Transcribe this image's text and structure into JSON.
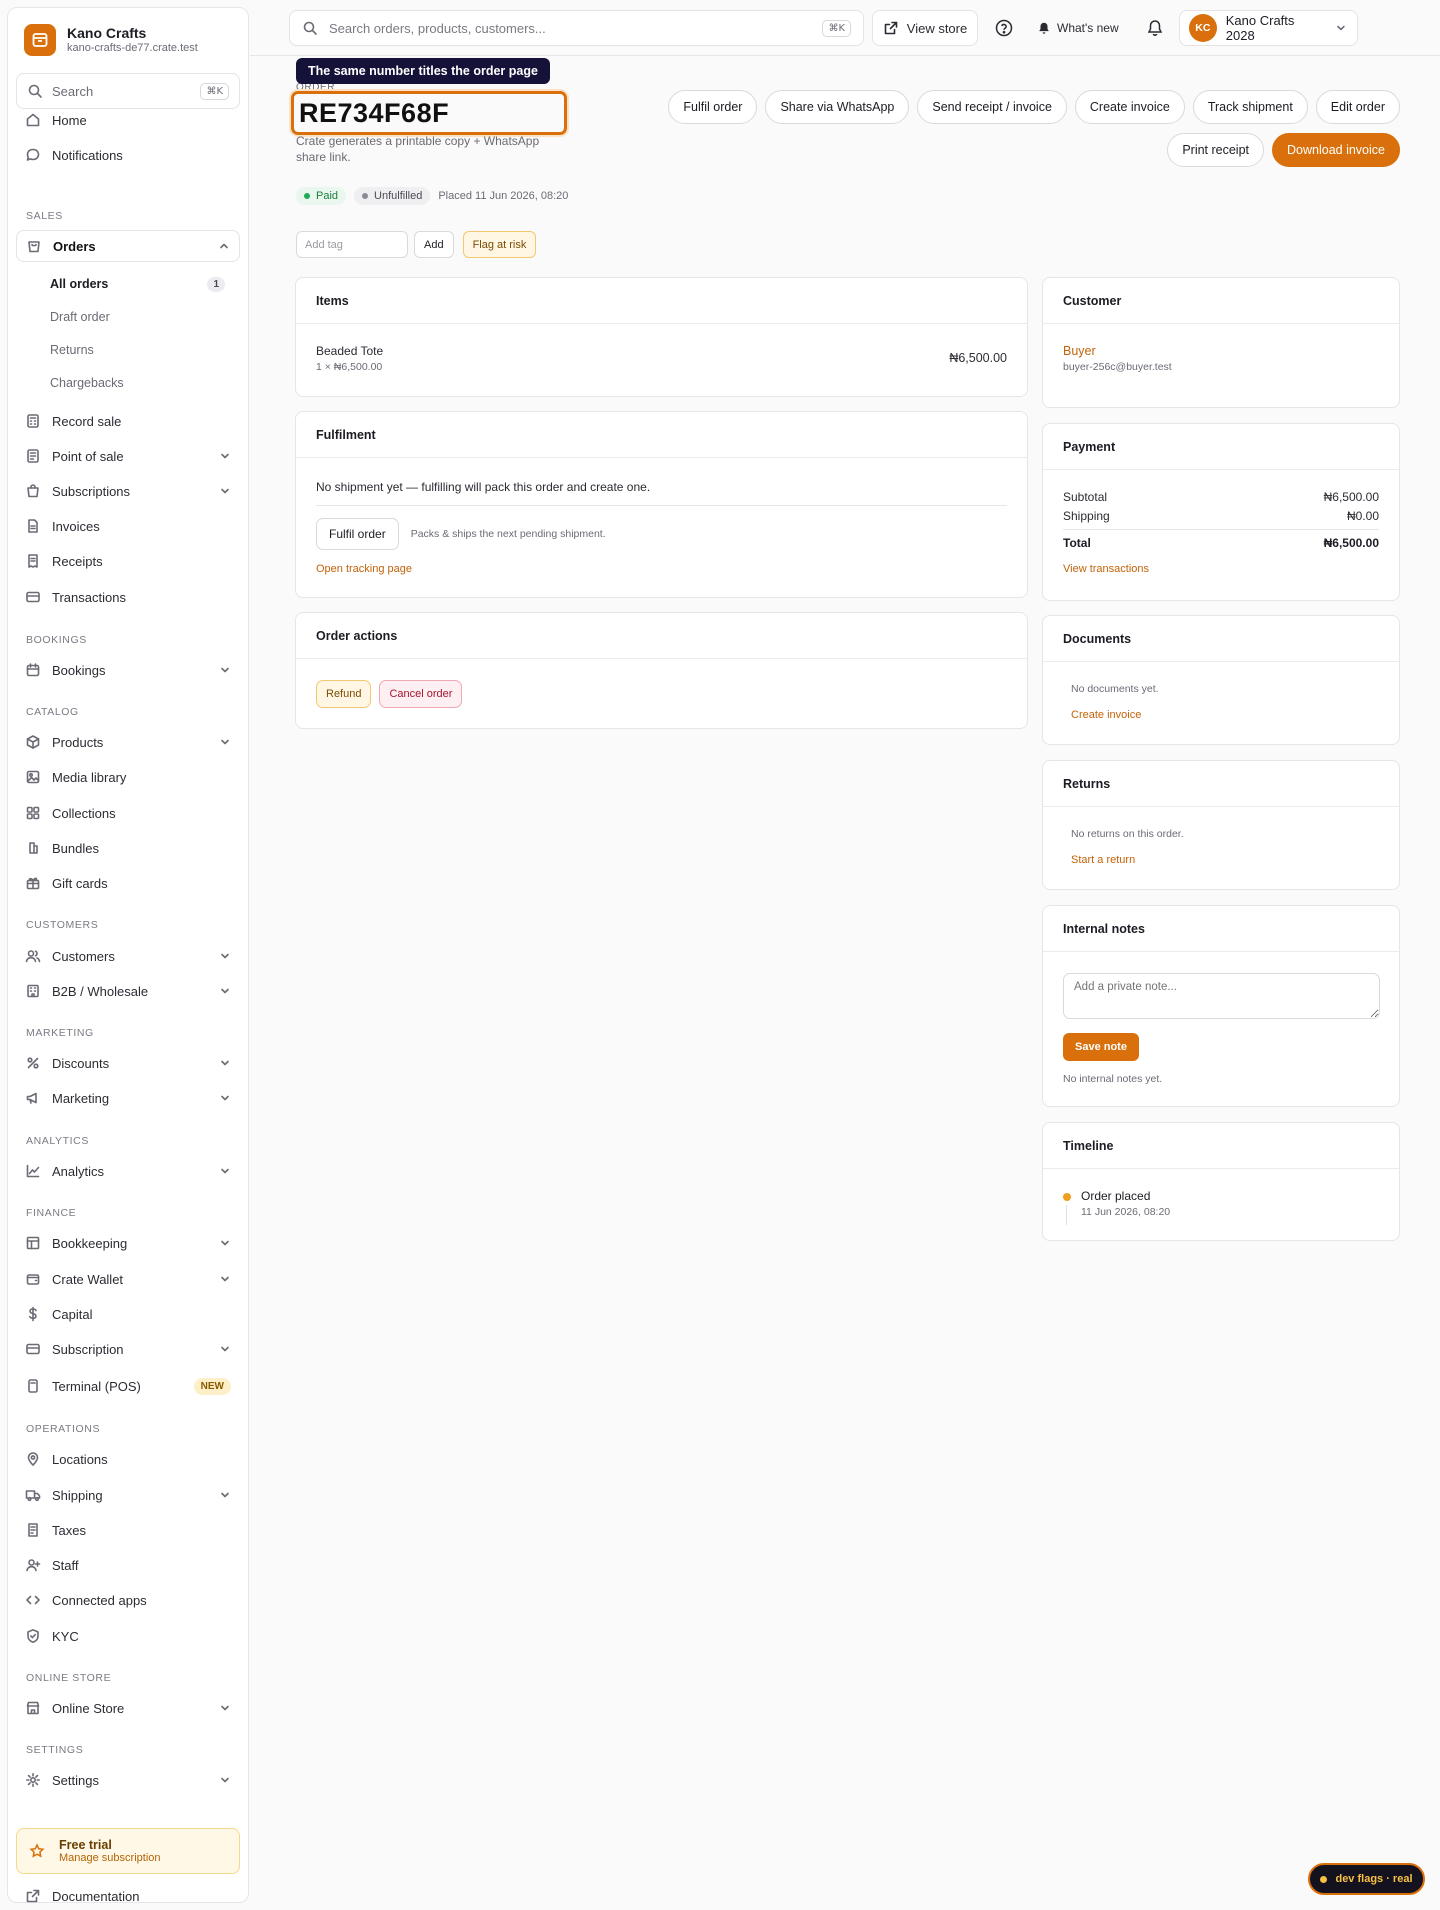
{
  "brand": {
    "name": "Kano Crafts",
    "url": "kano-crafts-de77.crate.test"
  },
  "sidebar": {
    "search_placeholder": "Search",
    "search_shortcut": "⌘K",
    "home": "Home",
    "notifications": "Notifications",
    "sections": {
      "sales": "SALES",
      "bookings": "BOOKINGS",
      "catalog": "CATALOG",
      "customers": "CUSTOMERS",
      "marketing": "MARKETING",
      "analytics": "ANALYTICS",
      "finance": "FINANCE",
      "operations": "OPERATIONS",
      "online_store": "ONLINE STORE",
      "settings": "SETTINGS"
    },
    "orders": "Orders",
    "orders_sub": {
      "all": "All orders",
      "all_count": "1",
      "draft": "Draft order",
      "returns": "Returns",
      "chargebacks": "Chargebacks"
    },
    "record_sale": "Record sale",
    "point_of_sale": "Point of sale",
    "subscriptions": "Subscriptions",
    "invoices": "Invoices",
    "receipts": "Receipts",
    "transactions": "Transactions",
    "bookings": "Bookings",
    "products": "Products",
    "media_library": "Media library",
    "collections": "Collections",
    "bundles": "Bundles",
    "gift_cards": "Gift cards",
    "customers": "Customers",
    "b2b": "B2B / Wholesale",
    "discounts": "Discounts",
    "marketing": "Marketing",
    "analytics": "Analytics",
    "bookkeeping": "Bookkeeping",
    "crate_wallet": "Crate Wallet",
    "capital": "Capital",
    "subscription": "Subscription",
    "terminal": "Terminal (POS)",
    "terminal_badge": "NEW",
    "locations": "Locations",
    "shipping": "Shipping",
    "taxes": "Taxes",
    "staff": "Staff",
    "connected_apps": "Connected apps",
    "kyc": "KYC",
    "online_store": "Online Store",
    "settings": "Settings",
    "trial_title": "Free trial",
    "trial_sub": "Manage subscription",
    "documentation": "Documentation"
  },
  "topbar": {
    "search_placeholder": "Search orders, products, customers...",
    "search_shortcut": "⌘K",
    "view_store": "View store",
    "whats_new": "What's new",
    "avatar_initials": "KC",
    "account_name": "Kano Crafts 2028"
  },
  "order": {
    "tooltip": "The same number titles the order page",
    "label": "ORDER",
    "number": "RE734F68F",
    "subtitle": "Crate generates a printable copy + WhatsApp share link.",
    "payment_status": "Paid",
    "fulfilment_status": "Unfulfilled",
    "placed": "Placed 11 Jun 2026, 08:20",
    "tag_placeholder": "Add tag",
    "add_tag": "Add",
    "flag": "Flag at risk"
  },
  "actions": {
    "fulfil": "Fulfil order",
    "share": "Share via WhatsApp",
    "send_receipt": "Send receipt / invoice",
    "create_invoice": "Create invoice",
    "track": "Track shipment",
    "edit": "Edit order",
    "print": "Print receipt",
    "download": "Download invoice"
  },
  "items": {
    "title": "Items",
    "product": "Beaded Tote",
    "qty_price": "1 × ₦6,500.00",
    "total": "₦6,500.00"
  },
  "fulfilment": {
    "title": "Fulfilment",
    "message": "No shipment yet — fulfilling will pack this order and create one.",
    "button": "Fulfil order",
    "hint": "Packs & ships the next pending shipment.",
    "tracking_link": "Open tracking page"
  },
  "order_actions": {
    "title": "Order actions",
    "refund": "Refund",
    "cancel": "Cancel order"
  },
  "customer": {
    "title": "Customer",
    "name": "Buyer",
    "email": "buyer-256c@buyer.test"
  },
  "payment": {
    "title": "Payment",
    "subtotal_label": "Subtotal",
    "subtotal": "₦6,500.00",
    "shipping_label": "Shipping",
    "shipping": "₦0.00",
    "total_label": "Total",
    "total": "₦6,500.00",
    "view_transactions": "View transactions"
  },
  "documents": {
    "title": "Documents",
    "empty": "No documents yet.",
    "create": "Create invoice"
  },
  "returns": {
    "title": "Returns",
    "empty": "No returns on this order.",
    "start": "Start a return"
  },
  "notes": {
    "title": "Internal notes",
    "placeholder": "Add a private note...",
    "save": "Save note",
    "empty": "No internal notes yet."
  },
  "timeline": {
    "title": "Timeline",
    "event": "Order placed",
    "time": "11 Jun 2026, 08:20"
  },
  "dev_flags": "dev flags · real",
  "colors": {
    "accent": "#d9700b",
    "paid": "#1a7f3d",
    "tooltip_bg": "#15123a"
  }
}
